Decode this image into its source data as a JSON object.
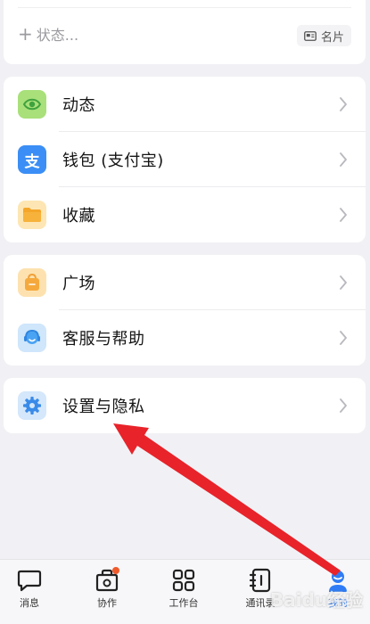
{
  "profile": {
    "status_placeholder": "状态...",
    "card_chip_label": "名片"
  },
  "menu_group_1": [
    {
      "label": "动态"
    },
    {
      "label": "钱包 (支付宝)"
    },
    {
      "label": "收藏"
    }
  ],
  "menu_group_2": [
    {
      "label": "广场"
    },
    {
      "label": "客服与帮助"
    }
  ],
  "menu_group_3": [
    {
      "label": "设置与隐私"
    }
  ],
  "bottom_nav": {
    "items": [
      {
        "label": "消息",
        "icon": "chat-bubble-icon",
        "active": false
      },
      {
        "label": "协作",
        "icon": "collaborate-icon",
        "active": false,
        "badge": true
      },
      {
        "label": "工作台",
        "icon": "grid-icon",
        "active": false
      },
      {
        "label": "通讯录",
        "icon": "contacts-icon",
        "active": false
      },
      {
        "label": "我的",
        "icon": "profile-icon",
        "active": true
      }
    ]
  },
  "colors": {
    "accent_blue": "#2f7cf6",
    "arrow_red": "#e8232a",
    "badge_orange": "#f05a2b"
  },
  "watermark": "Baidu经验"
}
